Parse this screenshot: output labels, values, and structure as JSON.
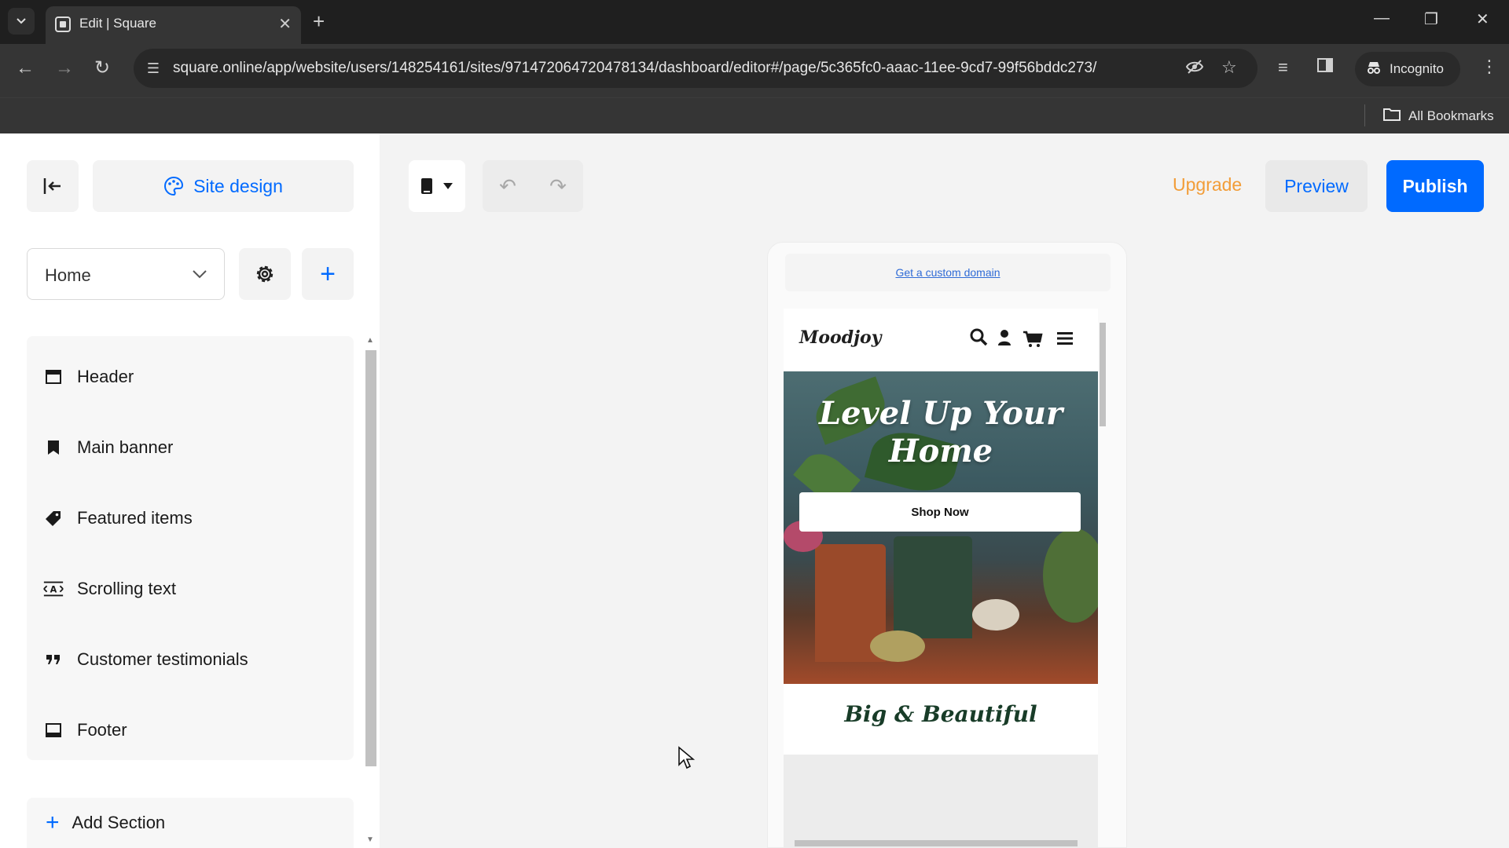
{
  "browser": {
    "tab_title": "Edit | Square",
    "url": "square.online/app/website/users/148254161/sites/971472064720478134/dashboard/editor#/page/5c365fc0-aaac-11ee-9cd7-99f56bddc273/",
    "incognito_label": "Incognito",
    "bookmarks_label": "All Bookmarks"
  },
  "editor": {
    "site_design_label": "Site design",
    "page_select_value": "Home",
    "sections": [
      {
        "label": "Header",
        "icon": "header-icon"
      },
      {
        "label": "Main banner",
        "icon": "bookmark-icon"
      },
      {
        "label": "Featured items",
        "icon": "tag-icon"
      },
      {
        "label": "Scrolling text",
        "icon": "scrolling-text-icon"
      },
      {
        "label": "Customer testimonials",
        "icon": "quote-icon"
      },
      {
        "label": "Footer",
        "icon": "footer-icon"
      }
    ],
    "add_section_label": "Add Section",
    "upgrade_label": "Upgrade",
    "preview_label": "Preview",
    "publish_label": "Publish"
  },
  "preview": {
    "custom_domain_link": "Get a custom domain",
    "logo": "Moodjoy",
    "hero_title": "Level Up Your Home",
    "shop_button": "Shop Now",
    "section_heading": "Big & Beautiful"
  },
  "colors": {
    "accent": "#006aff",
    "upgrade": "#f29d38",
    "heading_green": "#183c28"
  }
}
